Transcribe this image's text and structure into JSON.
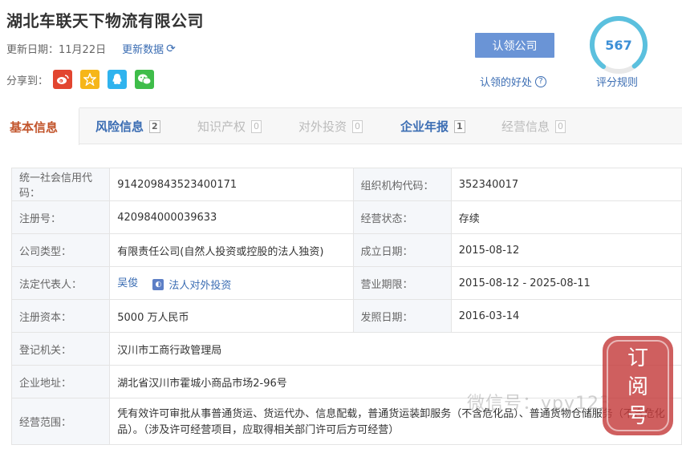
{
  "header": {
    "company_name": "湖北车联天下物流有限公司",
    "update_label": "更新日期：11月22日",
    "refresh_label": "更新数据",
    "share_label": "分享到："
  },
  "share": {
    "weibo_icon": "weibo-icon",
    "qzone_icon": "qzone-icon",
    "qq_icon": "qq-icon",
    "wechat_icon": "wechat-icon"
  },
  "claim": {
    "button_label": "认领公司",
    "benefit_label": "认领的好处"
  },
  "score": {
    "value": "567",
    "rules_label": "评分规则",
    "ring_color": "#5bc0de"
  },
  "tabs": [
    {
      "label": "基本信息",
      "count": ""
    },
    {
      "label": "风险信息",
      "count": "2"
    },
    {
      "label": "知识产权",
      "count": "0"
    },
    {
      "label": "对外投资",
      "count": "0"
    },
    {
      "label": "企业年报",
      "count": "1"
    },
    {
      "label": "经营信息",
      "count": "0"
    }
  ],
  "info": {
    "credit_code_label": "统一社会信用代码：",
    "credit_code": "914209843523400171",
    "org_code_label": "组织机构代码：",
    "org_code": "352340017",
    "reg_no_label": "注册号：",
    "reg_no": "420984000039633",
    "status_label": "经营状态：",
    "status": "存续",
    "type_label": "公司类型：",
    "type": "有限责任公司(自然人投资或控股的法人独资)",
    "founded_label": "成立日期：",
    "founded": "2015-08-12",
    "rep_label": "法定代表人：",
    "rep_name": "吴俊",
    "rep_invest": "法人对外投资",
    "term_label": "营业期限：",
    "term": "2015-08-12 - 2025-08-11",
    "capital_label": "注册资本：",
    "capital": "5000 万人民币",
    "issue_label": "发照日期：",
    "issue": "2016-03-14",
    "authority_label": "登记机关：",
    "authority": "汉川市工商行政管理局",
    "address_label": "企业地址：",
    "address": "湖北省汉川市霍城小商品市场2-96号",
    "scope_label": "经营范围：",
    "scope": "凭有效许可审批从事普通货运、货运代办、信息配载，普通货运装卸服务（不含危化品）、普通货物仓储服务（不含危化品）。（涉及许可经营项目，应取得相关部门许可后方可经营）"
  },
  "overlay": {
    "watermark": "微信号：ypy123",
    "seal_text": "订阅号"
  }
}
